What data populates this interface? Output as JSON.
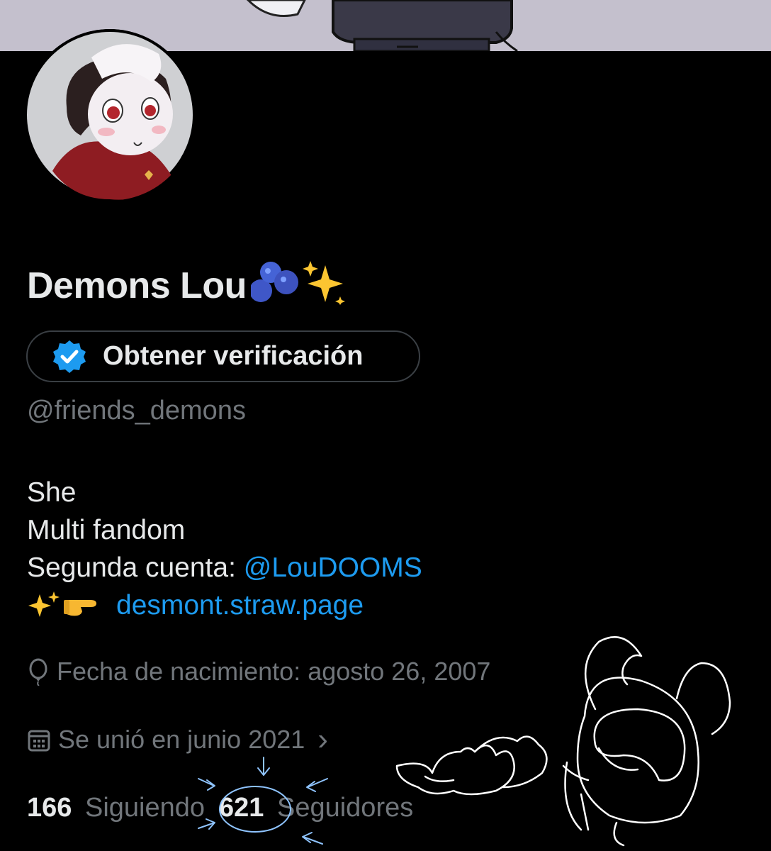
{
  "profile": {
    "display_name": "Demons Lou",
    "name_emojis": "🫐✨",
    "verify_button_label": "Obtener verificación",
    "handle": "@friends_demons"
  },
  "bio": {
    "line1": "She",
    "line2": "Multi fandom",
    "line3_text": "Segunda cuenta: ",
    "line3_mention": "@LouDOOMS",
    "line4_emojis": "✨👉",
    "line4_link": "desmont.straw.page"
  },
  "meta": {
    "birthday": "Fecha de nacimiento: agosto 26, 2007",
    "joined": "Se unió en junio 2021",
    "joined_chevron": "›"
  },
  "stats": {
    "following_count": "166",
    "following_label": "Siguiendo",
    "followers_count": "621",
    "followers_label": "Seguidores"
  },
  "colors": {
    "background": "#000000",
    "text_primary": "#e7e9ea",
    "text_secondary": "#71767b",
    "link": "#1d9bf0",
    "verified_badge": "#1d9bf0"
  }
}
